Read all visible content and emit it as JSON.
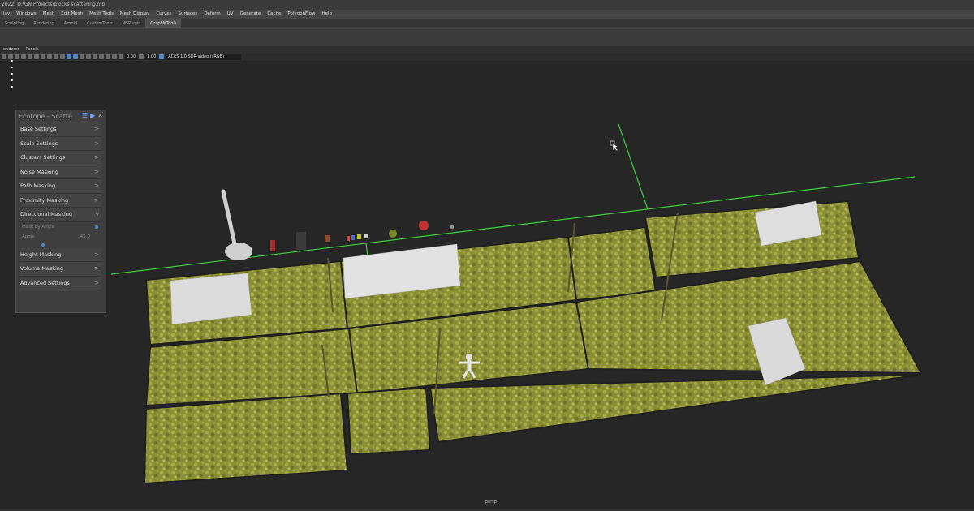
{
  "window": {
    "title": "2022: D:\\GN Projects\\blocks scattering.mb"
  },
  "menu": [
    "lay",
    "Windows",
    "Mesh",
    "Edit Mesh",
    "Mesh Tools",
    "Mesh Display",
    "Curves",
    "Surfaces",
    "Deform",
    "UV",
    "Generate",
    "Cache",
    "PolygonFlow",
    "Help"
  ],
  "shelf_tabs": [
    "Sculpting",
    "Rendering",
    "Arnold",
    "CustomTools",
    "MSPlugin",
    "GraphMTools"
  ],
  "active_shelf_tab": "GraphMTools",
  "panel_menu": [
    "enderer",
    "Panels"
  ],
  "viewport_toolbar": {
    "field1": "0.00",
    "field2": "1.00",
    "color_space": "ACES 1.0 SDR-video (sRGB)"
  },
  "ecotope_panel": {
    "title": "Ecotope - Scatte",
    "items": [
      {
        "label": "Base Settings",
        "chevron": ">"
      },
      {
        "label": "Scale Settings",
        "chevron": ">"
      },
      {
        "label": "Clusters Settings",
        "chevron": ">"
      },
      {
        "label": "Noise Masking",
        "chevron": ">"
      },
      {
        "label": "Path Masking",
        "chevron": ">"
      },
      {
        "label": "Proximity Masking",
        "chevron": ">"
      },
      {
        "label": "Directional Masking",
        "chevron": "v"
      }
    ],
    "mask_by_angle": "Mask by Angle",
    "angle_label": "Angle",
    "angle_value": "45.0",
    "items_after": [
      {
        "label": "Height Masking",
        "chevron": ">"
      },
      {
        "label": "Volume Masking",
        "chevron": ">"
      },
      {
        "label": "Advanced Settings",
        "chevron": ">"
      }
    ]
  },
  "viewport": {
    "camera_label": "persp"
  },
  "colors": {
    "grass": "#8f9438",
    "accent": "#4f86c6",
    "grid_green": "#3bd13b",
    "box": "#d8d8d8"
  }
}
